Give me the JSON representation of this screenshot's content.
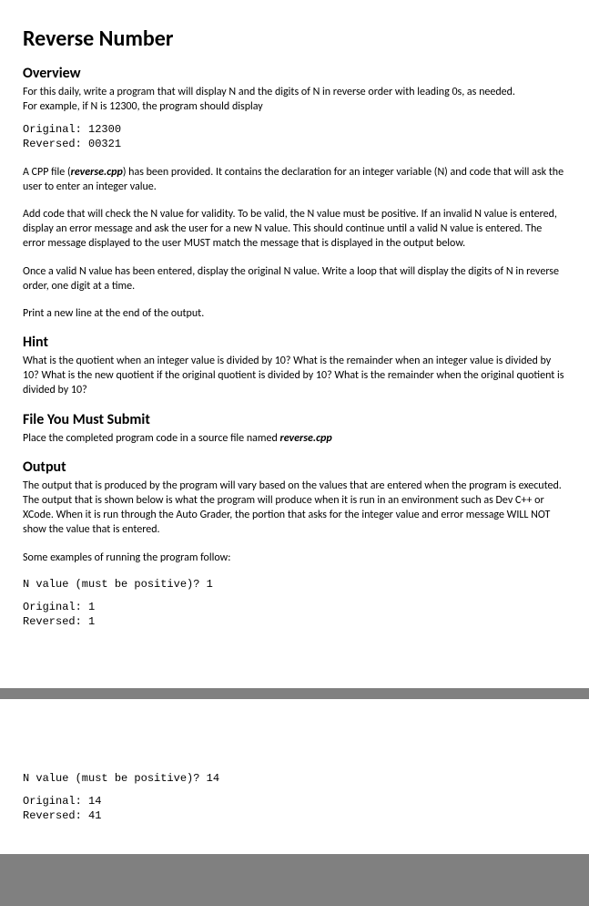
{
  "title": "Reverse Number",
  "section_overview": {
    "heading": "Overview",
    "p1a": "For this daily, write a program that will display N and the digits of N in reverse order with leading 0s, as needed.",
    "p1b": "For example, if N is 12300, the program should display",
    "code_example": "Original: 12300\nReversed: 00321",
    "p2a": "A CPP file (",
    "p2_bold": "reverse.cpp",
    "p2b": ") has been provided. It contains the declaration for an integer variable (N) and code that will ask the user to enter an integer value.",
    "p3": "Add code that will check the N value for validity. To be valid, the N value must be positive. If an invalid N value is entered, display an error message and ask the user for a new N value. This should continue until a valid N value is entered. The error message displayed to the user MUST match the message that is displayed in the output below.",
    "p4": "Once a valid N value has been entered, display the original N value. Write a loop that will display the digits of N in reverse order, one digit at a time.",
    "p5": "Print a new line at the end of the output."
  },
  "section_hint": {
    "heading": "Hint",
    "p1": "What is the quotient when an integer value is divided by 10? What is the remainder when an integer value is divided by 10? What is the new quotient if the original quotient is divided by 10? What is the remainder when the original quotient is divided by 10?"
  },
  "section_file": {
    "heading": "File You Must Submit",
    "p1a": "Place the completed program code in a source file named ",
    "p1_bold": "reverse.cpp"
  },
  "section_output": {
    "heading": "Output",
    "p1": "The output that is produced by the program will vary based on the values that are entered when the program is executed. The output that is shown below is what the program will produce when it is run in an environment such as Dev C++ or XCode. When it is run through the Auto Grader, the portion that asks for the integer value and error message WILL NOT show the value that is entered.",
    "p2": "Some examples of running the program follow:",
    "example1_input": "N value (must be positive)? 1",
    "example1_output": "Original: 1\nReversed: 1",
    "example2_input": "N value (must be positive)? 14",
    "example2_output": "Original: 14\nReversed: 41"
  }
}
